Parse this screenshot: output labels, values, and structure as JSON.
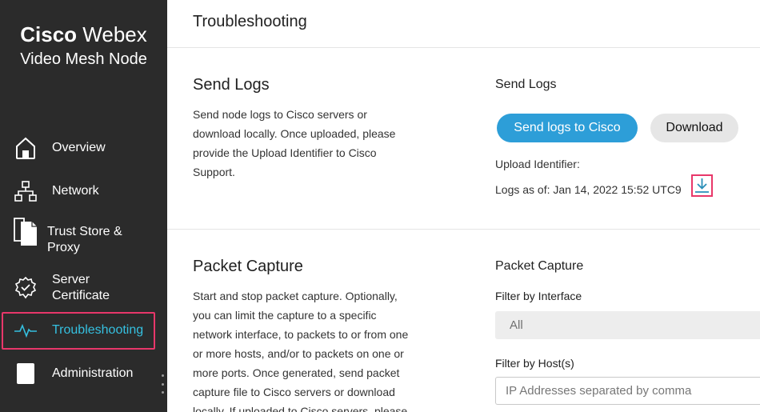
{
  "brand": {
    "name_bold": "Cisco",
    "name_light": "Webex",
    "product": "Video Mesh Node"
  },
  "sidebar": {
    "items": [
      {
        "label": "Overview",
        "icon": "home-icon"
      },
      {
        "label": "Network",
        "icon": "network-icon"
      },
      {
        "label": "Trust Store &",
        "label2": "Proxy",
        "icon": "documents-icon"
      },
      {
        "label": "Server",
        "label2": "Certificate",
        "icon": "certificate-badge-icon"
      },
      {
        "label": "Troubleshooting",
        "icon": "pulse-icon",
        "active": true
      },
      {
        "label": "Administration",
        "icon": "device-icon"
      }
    ]
  },
  "page": {
    "title": "Troubleshooting"
  },
  "send_logs": {
    "title": "Send Logs",
    "description_lines": [
      "Send node logs to Cisco servers or",
      "download locally. Once uploaded, please",
      "provide the Upload Identifier to Cisco",
      "Support."
    ],
    "panel_title": "Send Logs",
    "send_button": "Send logs to Cisco",
    "download_button": "Download",
    "upload_identifier_label": "Upload Identifier:",
    "logs_as_of": "Logs as of: Jan 14, 2022 15:52 UTC9"
  },
  "packet_capture": {
    "title": "Packet Capture",
    "description_lines": [
      "Start and stop packet capture. Optionally,",
      "you can limit the capture to a specific",
      "network interface, to packets to or from one",
      "or more hosts, and/or to packets on one or",
      "more ports. Once generated, send packet",
      "capture file to Cisco servers or download",
      "locally. If uploaded to Cisco servers, please"
    ],
    "panel_title": "Packet Capture",
    "filter_interface_label": "Filter by Interface",
    "filter_interface_value": "All",
    "filter_hosts_label": "Filter by Host(s)",
    "filter_hosts_placeholder": "IP Addresses separated by comma"
  },
  "colors": {
    "sidebar_bg": "#2b2b2b",
    "accent": "#35c0e0",
    "primary_button": "#2d9ed8",
    "highlight": "#e8376a"
  }
}
